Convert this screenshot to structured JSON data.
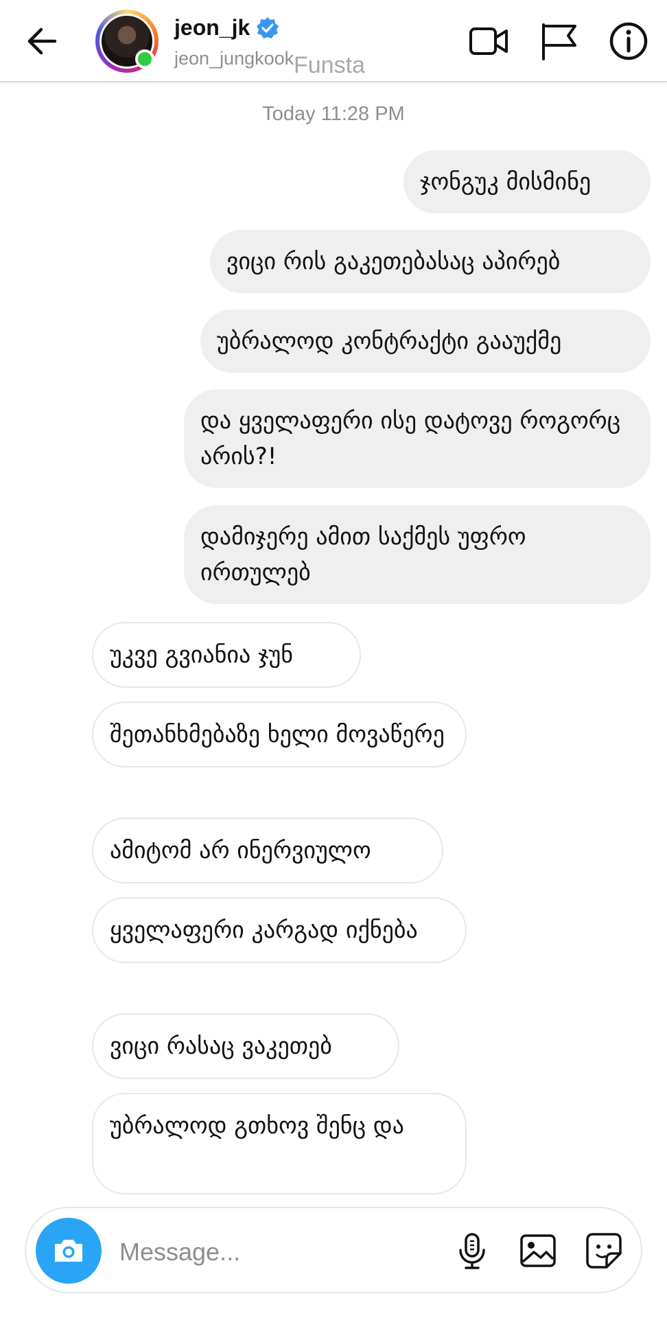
{
  "header": {
    "username": "jeon_jk",
    "handle": "jeon_jungkook",
    "watermark": "Funsta"
  },
  "timestamp": "Today 11:28 PM",
  "messages": {
    "sent": [
      "ჯონგუკ მისმინე",
      "ვიცი რის გაკეთებასაც აპირებ",
      "უბრალოდ კონტრაქტი გააუქმე",
      "და ყველაფერი ისე დატოვე როგორც არის?!",
      "დამიჯერე ამით საქმეს უფრო ირთულებ"
    ],
    "received": [
      "უკვე გვიანია ჯუნ",
      "შეთანხმებაზე ხელი მოვაწერე",
      "ამიტომ არ ინერვიულო",
      "ყველაფერი კარგად იქნება",
      "ვიცი რასაც ვაკეთებ",
      "უბრალოდ გთხოვ შენც და"
    ]
  },
  "composer": {
    "placeholder": "Message..."
  },
  "colors": {
    "accent": "#2aa5f5",
    "verified": "#3897f0",
    "online": "#2ecc40",
    "sent_bubble": "#efefef"
  },
  "icons": {
    "back": "arrow-left-icon",
    "video": "video-camera-icon",
    "report": "flag-icon",
    "info": "info-icon",
    "camera": "camera-icon",
    "mic": "microphone-icon",
    "gallery": "image-icon",
    "sticker": "sticker-icon"
  }
}
